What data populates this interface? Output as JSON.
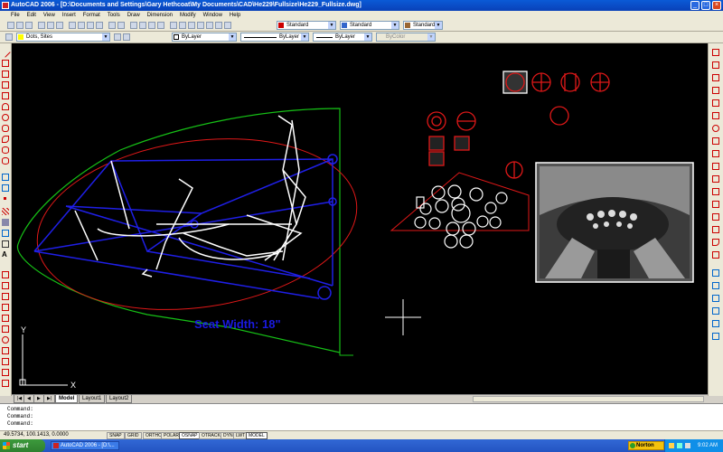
{
  "window": {
    "title": "AutoCAD 2006 - [D:\\Documents and Settings\\Gary Hethcoat\\My Documents\\CAD\\He229\\Fullsize\\He229_Fullsize.dwg]",
    "minimize": "_",
    "maximize": "□",
    "close": "×"
  },
  "menu": [
    "File",
    "Edit",
    "View",
    "Insert",
    "Format",
    "Tools",
    "Draw",
    "Dimension",
    "Modify",
    "Window",
    "Help"
  ],
  "toolbar": {
    "text_style": "Standard",
    "dim_style": "Standard",
    "table_style": "Standard",
    "layer": "Dots, Sites",
    "color": "ByLayer",
    "linetype": "ByLayer",
    "lineweight": "ByLayer",
    "plot_style": "ByColor"
  },
  "drawing": {
    "annotation": "Seat Width: 18\"",
    "ucs_x": "X",
    "ucs_y": "Y"
  },
  "tabs": [
    "Model",
    "Layout1",
    "Layout2"
  ],
  "command_lines": [
    "Command:",
    "Command:",
    "Command:"
  ],
  "status": {
    "coords": "49.5734, 100.1413, 0.0000",
    "buttons": [
      "SNAP",
      "GRID",
      "ORTHO",
      "POLAR",
      "OSNAP",
      "OTRACK",
      "DYN",
      "LWT",
      "MODEL"
    ]
  },
  "taskbar": {
    "start": "start",
    "task": "AutoCAD 2006 - [D:\\...",
    "norton": "Norton",
    "clock": "9:02 AM"
  },
  "colors": {
    "drawing_bg": "#000000",
    "blue_lines": "#1f1fe6",
    "green_lines": "#16c016",
    "red_lines": "#e01818",
    "annotation_text": "#1a1ae0"
  }
}
